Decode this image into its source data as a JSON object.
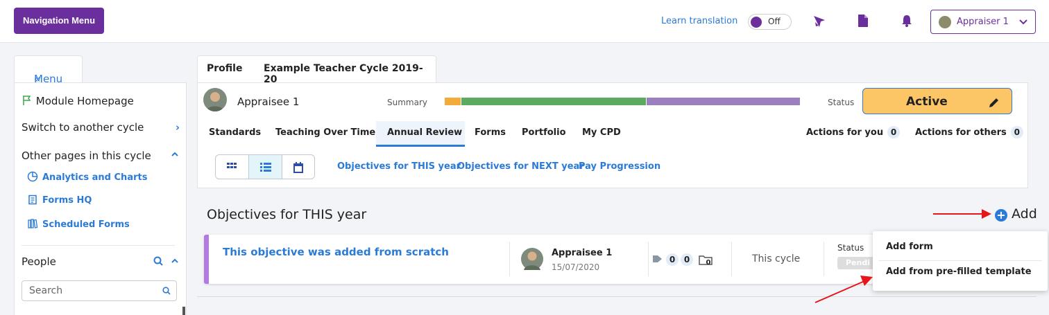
{
  "topbar": {
    "nav_button": "Navigation Menu",
    "learn_translation": "Learn translation",
    "toggle_label": "Off",
    "user_label": "Appraiser 1",
    "icons": [
      "rocket-icon",
      "document-icon",
      "bell-icon"
    ]
  },
  "sidebar": {
    "menu_label": "Menu",
    "module_homepage": "Module Homepage",
    "switch_cycle": "Switch to another cycle",
    "other_pages": "Other pages in this cycle",
    "links": [
      "Analytics and Charts",
      "Forms HQ",
      "Scheduled Forms"
    ],
    "people": "People",
    "search_placeholder": "Search"
  },
  "profile": {
    "tabs": [
      "Profile",
      "Example Teacher Cycle 2019-20"
    ],
    "name": "Appraisee 1",
    "summary_label": "Summary",
    "summary_bar": [
      {
        "color": "#f4a93b",
        "fraction": 0.047
      },
      {
        "color": "#5aab5e",
        "fraction": 0.521
      },
      {
        "color": "#9b7fbf",
        "fraction": 0.432
      }
    ],
    "status_label": "Status",
    "status_value": "Active",
    "subtabs": [
      "Standards",
      "Teaching Over Time",
      "Annual Review",
      "Forms",
      "Portfolio",
      "My CPD"
    ],
    "active_subtab": "Annual Review",
    "actions_for_you": "Actions for you",
    "actions_for_you_count": "0",
    "actions_for_others": "Actions for others",
    "actions_for_others_count": "0",
    "objective_links": [
      "Objectives for THIS year",
      "Objectives for NEXT year",
      "Pay Progression"
    ]
  },
  "objectives": {
    "title": "Objectives for THIS year",
    "add_label": "Add",
    "item": {
      "title": "This objective was added from scratch",
      "person": "Appraisee 1",
      "date": "15/07/2020",
      "tag_count": "0",
      "comment_count": "0",
      "folder_count": "0",
      "cycle": "This cycle",
      "status_label": "Status",
      "status_value": "Pendi"
    }
  },
  "dropdown": {
    "items": [
      "Add form",
      "Add from pre-filled template"
    ]
  },
  "colors": {
    "brand_purple": "#6a2f9c",
    "link_blue": "#2b7bd6",
    "active_yellow": "#fcc666",
    "annotation_red": "#e8141b"
  }
}
